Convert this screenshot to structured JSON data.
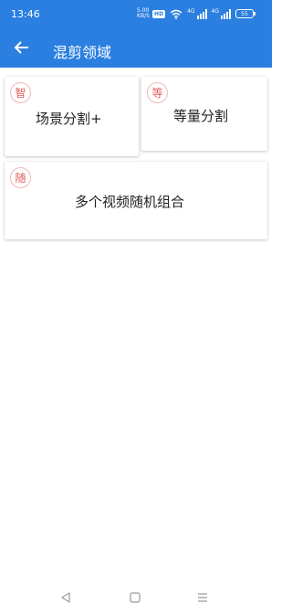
{
  "status_bar": {
    "time": "13:46",
    "speed_value": "5.00",
    "speed_unit": "KB/S",
    "hd_badge": "HD",
    "sim1_label": "4G",
    "sim2_label": "4G",
    "battery_level": "55",
    "icons": [
      "wifi-icon",
      "signal-icon",
      "signal-icon",
      "battery-icon"
    ]
  },
  "app_bar": {
    "back_icon": "arrow-left-icon",
    "title": "混剪领域",
    "color": "#2a7fe0"
  },
  "cards": [
    {
      "badge": "智",
      "label": "场景分割+"
    },
    {
      "badge": "等",
      "label": "等量分割"
    },
    {
      "badge": "随",
      "label": "多个视频随机组合"
    }
  ],
  "nav_bar": {
    "icons": [
      "back-triangle-icon",
      "home-square-icon",
      "menu-lines-icon"
    ]
  },
  "colors": {
    "accent": "#2a7fe0",
    "badge_text": "#e35a5a",
    "badge_border": "#f3b6b6"
  }
}
